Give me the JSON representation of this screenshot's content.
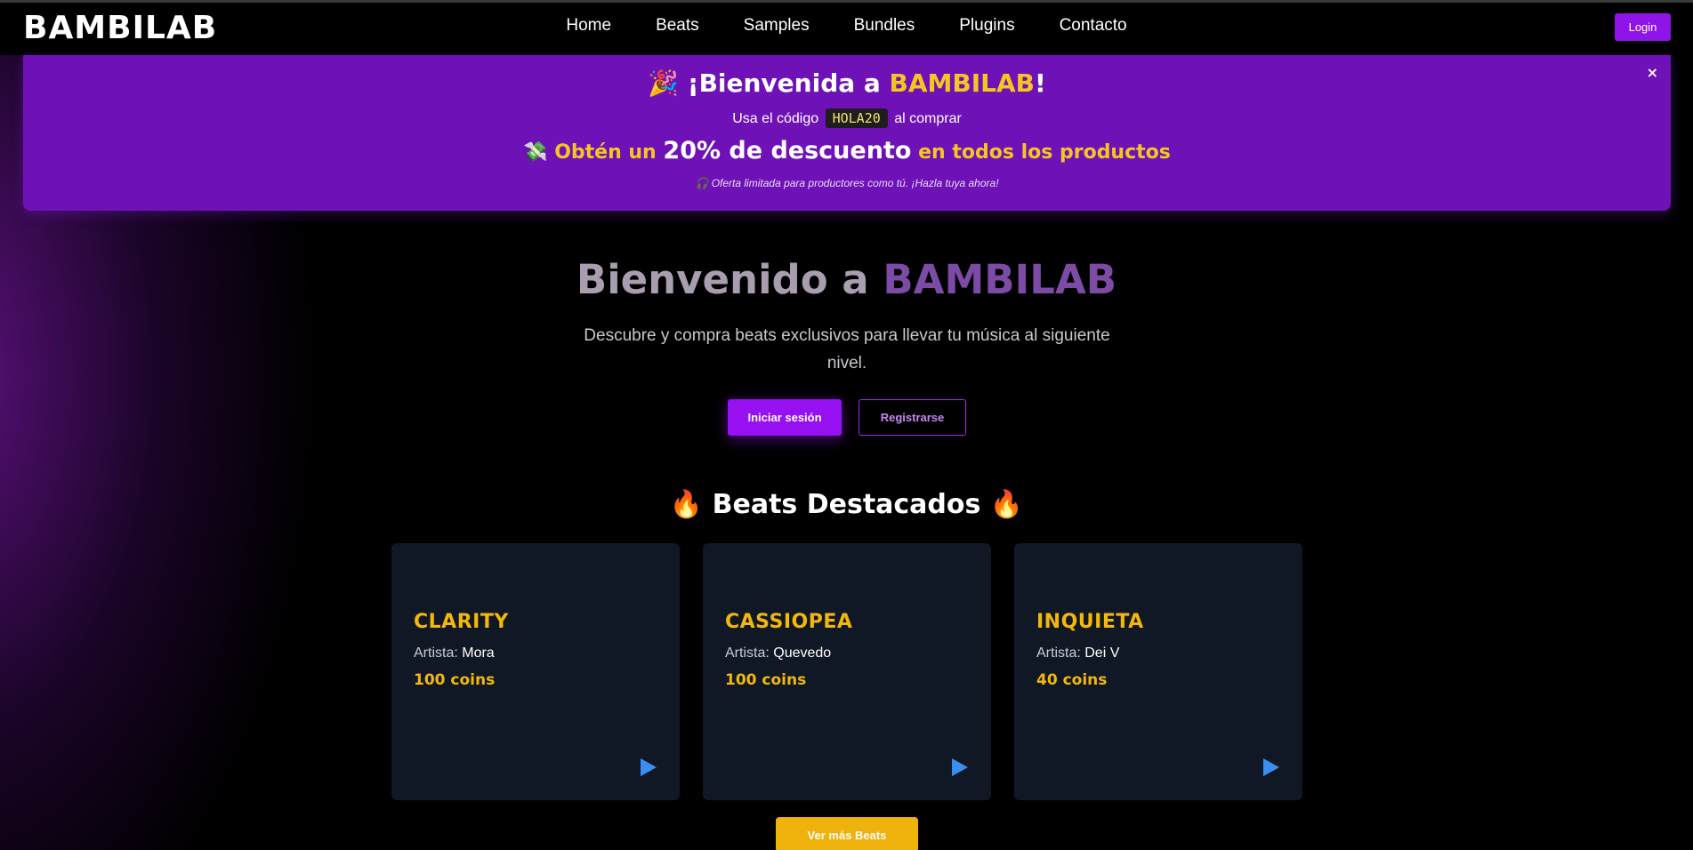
{
  "navbar": {
    "brand": "BAMBILAB",
    "links": [
      "Home",
      "Beats",
      "Samples",
      "Bundles",
      "Plugins",
      "Contacto"
    ],
    "login_label": "Login"
  },
  "promo": {
    "party_emoji": "🎉",
    "title_prefix": "¡Bienvenida a ",
    "title_highlight": "BAMBILAB",
    "title_suffix": "!",
    "code_prefix": "Usa el código",
    "code": "HOLA20",
    "code_suffix": "al comprar",
    "money_emoji": "💸",
    "discount_prefix": "Obtén un",
    "discount_value": "20% de descuento",
    "discount_suffix": "en todos los productos",
    "note": "🎧 Oferta limitada para productores como tú. ¡Hazla tuya ahora!",
    "close_label": "×"
  },
  "hero": {
    "title_prefix": "Bienvenido a ",
    "title_accent": "BAMBILAB",
    "subtitle": "Descubre y compra beats exclusivos para llevar tu música al siguiente nivel.",
    "login_button": "Iniciar sesión",
    "register_button": "Registrarse"
  },
  "featured": {
    "fire_emoji": "🔥",
    "title": "Beats Destacados",
    "artist_label": "Artista:",
    "beats": [
      {
        "title": "CLARITY",
        "artist": "Mora",
        "price": "100 coins"
      },
      {
        "title": "CASSIOPEA",
        "artist": "Quevedo",
        "price": "100 coins"
      },
      {
        "title": "INQUIETA",
        "artist": "Dei V",
        "price": "40 coins"
      }
    ],
    "more_button": "Ver más Beats"
  },
  "colors": {
    "accent_purple": "#9610f2",
    "banner_purple": "#6e12b8",
    "gold": "#f2b80b",
    "card_bg": "#101826",
    "play_blue": "#3b8ef0"
  }
}
